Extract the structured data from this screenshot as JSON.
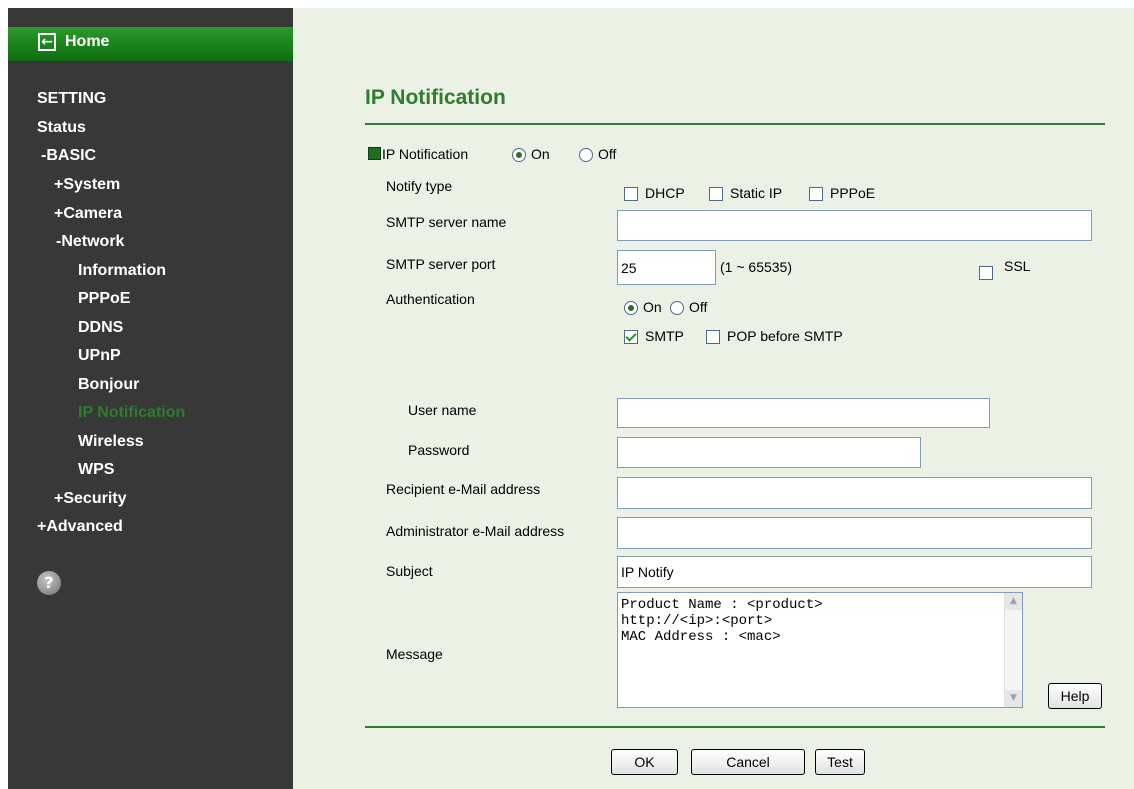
{
  "sidebar": {
    "home_label": "Home",
    "setting": "SETTING",
    "status": "Status",
    "basic": "-BASIC",
    "system": "+System",
    "camera": "+Camera",
    "network": "-Network",
    "network_items": [
      "Information",
      "PPPoE",
      "DDNS",
      "UPnP",
      "Bonjour",
      "IP Notification",
      "Wireless",
      "WPS"
    ],
    "security": "+Security",
    "advanced": "+Advanced",
    "help_glyph": "?"
  },
  "page": {
    "title": "IP Notification",
    "ip_notification_label": "IP Notification",
    "ip_notification_on": "On",
    "ip_notification_off": "Off",
    "notify_type_label": "Notify type",
    "notify_dhcp": "DHCP",
    "notify_static_ip": "Static IP",
    "notify_pppoe": "PPPoE",
    "smtp_server_name_label": "SMTP server name",
    "smtp_server_name_value": "",
    "smtp_server_port_label": "SMTP server port",
    "smtp_server_port_value": "25",
    "port_range": "(1 ~ 65535)",
    "ssl_label": "SSL",
    "authentication_label": "Authentication",
    "auth_on": "On",
    "auth_off": "Off",
    "auth_smtp": "SMTP",
    "auth_pop_before_smtp": "POP before SMTP",
    "user_name_label": "User name",
    "user_name_value": "",
    "password_label": "Password",
    "password_value": "",
    "recipient_label": "Recipient e-Mail address",
    "recipient_value": "",
    "admin_label": "Administrator e-Mail address",
    "admin_value": "",
    "subject_label": "Subject",
    "subject_value": "IP Notify",
    "message_label": "Message",
    "message_value": "Product Name : <product>\nhttp://<ip>:<port>\nMAC Address : <mac>",
    "help_button": "Help",
    "ok_button": "OK",
    "cancel_button": "Cancel",
    "test_button": "Test"
  },
  "state": {
    "ip_notification": "On",
    "notify_dhcp": false,
    "notify_static_ip": false,
    "notify_pppoe": false,
    "ssl": false,
    "authentication": "On",
    "auth_smtp": true,
    "auth_pop_before_smtp": false
  },
  "colors": {
    "sidebar_bg": "#383838",
    "home_bar": "#1a8a1f",
    "accent_green": "#2f7d2f",
    "content_bg": "#ebf1e5"
  },
  "icons": {
    "home": "back-arrow-icon",
    "help": "question-circle-icon",
    "scroll_up": "triangle-up-icon",
    "scroll_down": "triangle-down-icon"
  }
}
